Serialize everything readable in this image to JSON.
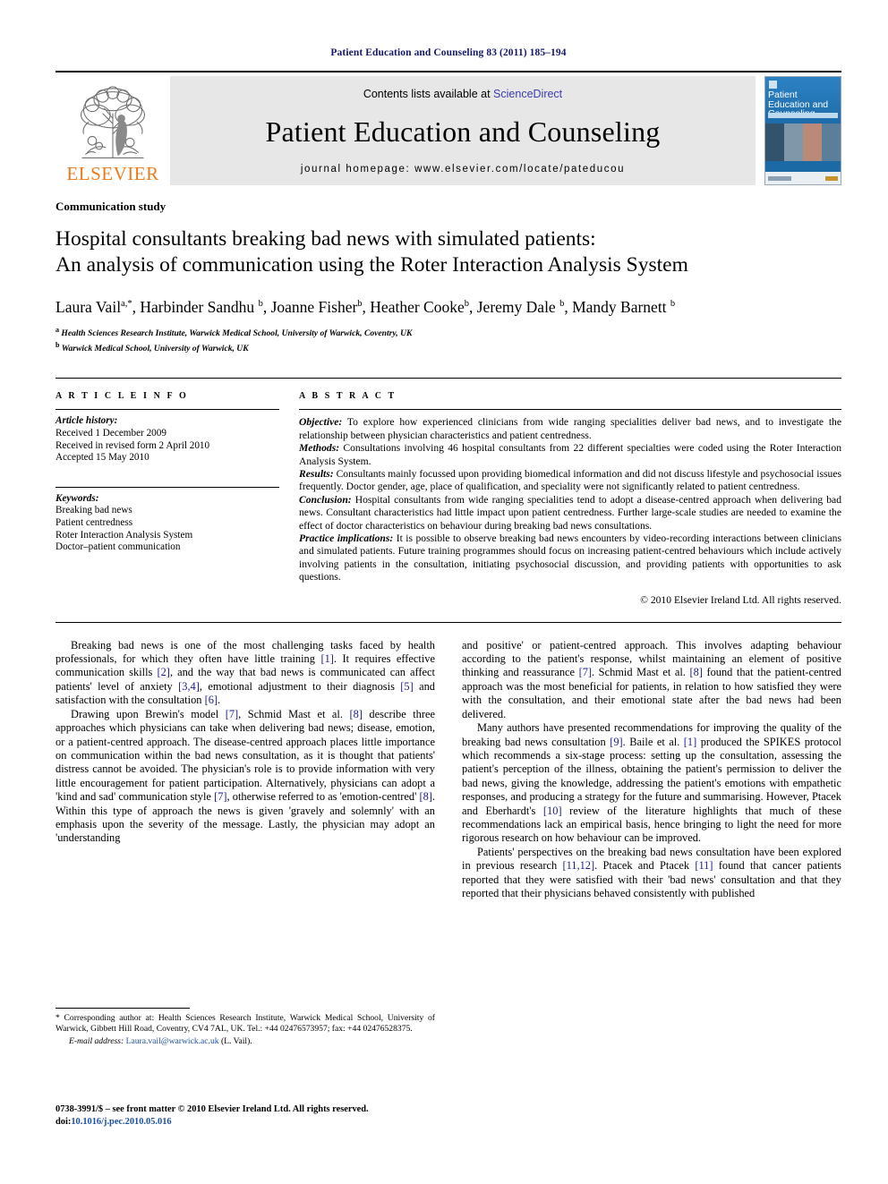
{
  "running_head": "Patient Education and Counseling 83 (2011) 185–194",
  "masthead": {
    "elsevier_wordmark": "ELSEVIER",
    "contents_prefix": "Contents lists available at",
    "sciencedirect": "ScienceDirect",
    "journal_name": "Patient Education and Counseling",
    "homepage": "journal homepage: www.elsevier.com/locate/pateducou",
    "cover_title": "Patient Education and Counseling",
    "link_color": "#3b3bb5"
  },
  "article": {
    "section_label": "Communication study",
    "title_line1": "Hospital consultants breaking bad news with simulated patients:",
    "title_line2": "An analysis of communication using the Roter Interaction Analysis System",
    "authors": "Laura Vail a,*, Harbinder Sandhu b, Joanne Fisher b, Heather Cooke b, Jeremy Dale b, Mandy Barnett b",
    "affiliation_a": "Health Sciences Research Institute, Warwick Medical School, University of Warwick, Coventry, UK",
    "affiliation_b": "Warwick Medical School, University of Warwick, UK"
  },
  "info": {
    "heading": "A R T I C L E   I N F O",
    "history_label": "Article history:",
    "history": [
      "Received 1 December 2009",
      "Received in revised form 2 April 2010",
      "Accepted 15 May 2010"
    ],
    "keywords_label": "Keywords:",
    "keywords": [
      "Breaking bad news",
      "Patient centredness",
      "Roter Interaction Analysis System",
      "Doctor–patient communication"
    ]
  },
  "abstract": {
    "heading": "A B S T R A C T",
    "sections": [
      {
        "label": "Objective:",
        "text": "To explore how experienced clinicians from wide ranging specialities deliver bad news, and to investigate the relationship between physician characteristics and patient centredness."
      },
      {
        "label": "Methods:",
        "text": "Consultations involving 46 hospital consultants from 22 different specialties were coded using the Roter Interaction Analysis System."
      },
      {
        "label": "Results:",
        "text": "Consultants mainly focussed upon providing biomedical information and did not discuss lifestyle and psychosocial issues frequently. Doctor gender, age, place of qualification, and speciality were not significantly related to patient centredness."
      },
      {
        "label": "Conclusion:",
        "text": "Hospital consultants from wide ranging specialities tend to adopt a disease-centred approach when delivering bad news. Consultant characteristics had little impact upon patient centredness. Further large-scale studies are needed to examine the effect of doctor characteristics on behaviour during breaking bad news consultations."
      },
      {
        "label": "Practice implications:",
        "text": "It is possible to observe breaking bad news encounters by video-recording interactions between clinicians and simulated patients. Future training programmes should focus on increasing patient-centred behaviours which include actively involving patients in the consultation, initiating psychosocial discussion, and providing patients with opportunities to ask questions."
      }
    ],
    "copyright": "© 2010 Elsevier Ireland Ltd. All rights reserved."
  },
  "body": {
    "left": [
      "Breaking bad news is one of the most challenging tasks faced by health professionals, for which they often have little training [1]. It requires effective communication skills [2], and the way that bad news is communicated can affect patients' level of anxiety [3,4], emotional adjustment to their diagnosis [5] and satisfaction with the consultation [6].",
      "Drawing upon Brewin's model [7], Schmid Mast et al. [8] describe three approaches which physicians can take when delivering bad news; disease, emotion, or a patient-centred approach. The disease-centred approach places little importance on communication within the bad news consultation, as it is thought that patients' distress cannot be avoided. The physician's role is to provide information with very little encouragement for patient participation. Alternatively, physicians can adopt a 'kind and sad' communication style [7], otherwise referred to as 'emotion-centred' [8]. Within this type of approach the news is given 'gravely and solemnly' with an emphasis upon the severity of the message. Lastly, the physician may adopt an 'understanding"
    ],
    "right": [
      "and positive' or patient-centred approach. This involves adapting behaviour according to the patient's response, whilst maintaining an element of positive thinking and reassurance [7]. Schmid Mast et al. [8] found that the patient-centred approach was the most beneficial for patients, in relation to how satisfied they were with the consultation, and their emotional state after the bad news had been delivered.",
      "Many authors have presented recommendations for improving the quality of the breaking bad news consultation [9]. Baile et al. [1] produced the SPIKES protocol which recommends a six-stage process: setting up the consultation, assessing the patient's perception of the illness, obtaining the patient's permission to deliver the bad news, giving the knowledge, addressing the patient's emotions with empathetic responses, and producing a strategy for the future and summarising. However, Ptacek and Eberhardt's [10] review of the literature highlights that much of these recommendations lack an empirical basis, hence bringing to light the need for more rigorous research on how behaviour can be improved.",
      "Patients' perspectives on the breaking bad news consultation have been explored in previous research [11,12]. Ptacek and Ptacek [11] found that cancer patients reported that they were satisfied with their 'bad news' consultation and that they reported that their physicians behaved consistently with published"
    ]
  },
  "footnotes": {
    "corresponding": "* Corresponding author at: Health Sciences Research Institute, Warwick Medical School, University of Warwick, Gibbett Hill Road, Coventry, CV4 7AL, UK. Tel.: +44 02476573957; fax: +44 02476528375.",
    "email_label": "E-mail address:",
    "email": "Laura.vail@warwick.ac.uk",
    "email_suffix": "(L. Vail).",
    "issn_line": "0738-3991/$ – see front matter © 2010 Elsevier Ireland Ltd. All rights reserved.",
    "doi_label": "doi:",
    "doi": "10.1016/j.pec.2010.05.016"
  }
}
